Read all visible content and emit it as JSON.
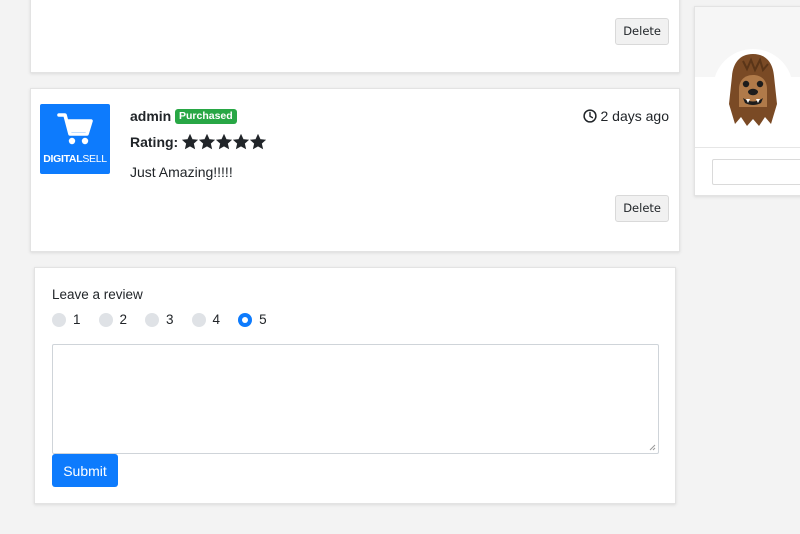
{
  "top_card": {
    "delete_label": "Delete"
  },
  "review": {
    "logo_bold": "DIGITAL",
    "logo_light": "SELL",
    "author": "admin",
    "badge": "Purchased",
    "rating_label": "Rating:",
    "rating": 5,
    "rating_max": 5,
    "text": "Just Amazing!!!!!",
    "time": "2 days ago",
    "delete_label": "Delete"
  },
  "leave_review": {
    "title": "Leave a review",
    "options": [
      "1",
      "2",
      "3",
      "4",
      "5"
    ],
    "selected": "5",
    "textarea_value": "",
    "submit_label": "Submit"
  },
  "colors": {
    "primary": "#0d7bfd",
    "success": "#28a745"
  },
  "icons": {
    "logo": "shopping-cart-icon",
    "clock": "clock-icon",
    "star": "star-icon",
    "avatar": "chewbacca-avatar"
  }
}
